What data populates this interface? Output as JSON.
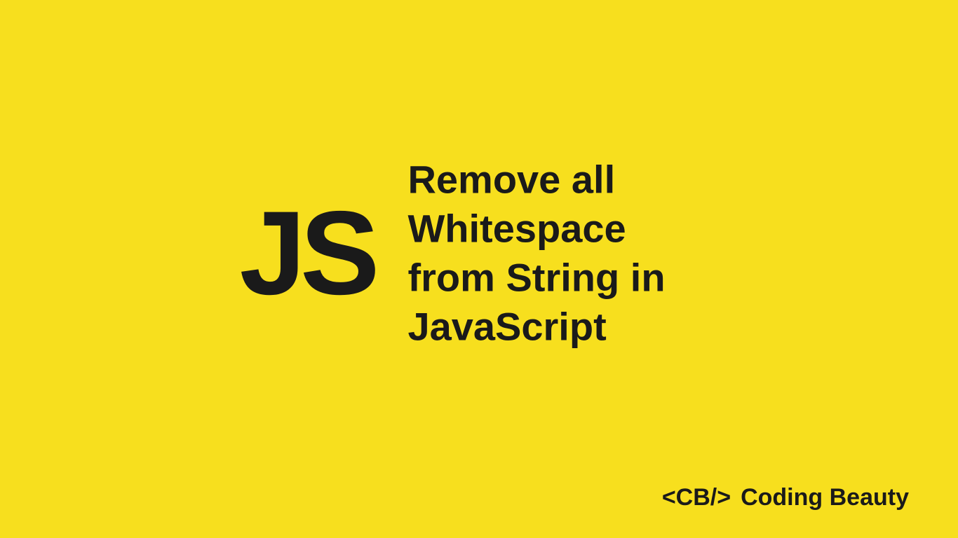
{
  "badge": {
    "text": "JS"
  },
  "title": {
    "line1": "Remove all Whitespace",
    "line2": "from String in JavaScript"
  },
  "footer": {
    "logo_tag": "<CB/>",
    "brand_name": "Coding Beauty"
  },
  "colors": {
    "background": "#f7df1e",
    "text": "#1a1a1a"
  }
}
